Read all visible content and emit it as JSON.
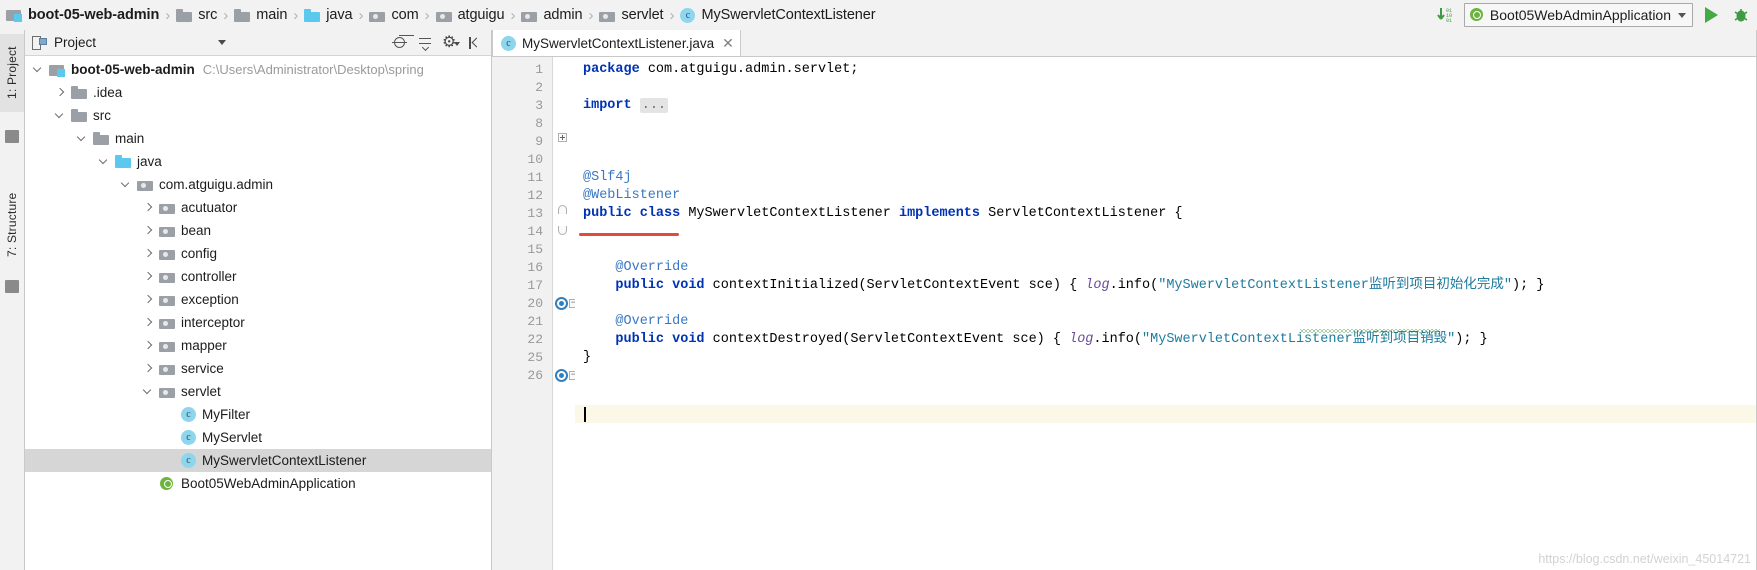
{
  "navbar": {
    "breadcrumb": [
      {
        "label": "boot-05-web-admin",
        "icon": "module-icon"
      },
      {
        "label": "src",
        "icon": "folder-icon"
      },
      {
        "label": "main",
        "icon": "folder-icon"
      },
      {
        "label": "java",
        "icon": "source-folder-icon"
      },
      {
        "label": "com",
        "icon": "package-icon"
      },
      {
        "label": "atguigu",
        "icon": "package-icon"
      },
      {
        "label": "admin",
        "icon": "package-icon"
      },
      {
        "label": "servlet",
        "icon": "package-icon"
      },
      {
        "label": "MySwervletContextListener",
        "icon": "java-class-icon"
      }
    ],
    "separator": "›",
    "run_config": {
      "label": "Boot05WebAdminApplication",
      "icon": "spring-boot-icon",
      "dropdown_icon": "chevron-down-icon"
    },
    "download_icon": "download-binary-icon",
    "run_icon": "run-triangle-icon",
    "debug_icon": "debug-bug-icon"
  },
  "toolstrip": {
    "project_tab": "1: Project",
    "structure_tab": "7: Structure"
  },
  "project_panel": {
    "title": "Project",
    "header_icons": [
      "select-opened-file-icon",
      "collapse-all-icon",
      "settings-gear-icon",
      "hide-panel-icon"
    ],
    "tree": [
      {
        "label": "boot-05-web-admin",
        "path": "C:\\Users\\Administrator\\Desktop\\spring",
        "indent": 0,
        "arrow": "down",
        "icon": "module-icon",
        "bold": true,
        "selected": false
      },
      {
        "label": ".idea",
        "path": "",
        "indent": 1,
        "arrow": "right",
        "icon": "folder-icon",
        "bold": false,
        "selected": false
      },
      {
        "label": "src",
        "path": "",
        "indent": 1,
        "arrow": "down",
        "icon": "folder-icon",
        "bold": false,
        "selected": false
      },
      {
        "label": "main",
        "path": "",
        "indent": 2,
        "arrow": "down",
        "icon": "folder-icon",
        "bold": false,
        "selected": false
      },
      {
        "label": "java",
        "path": "",
        "indent": 3,
        "arrow": "down",
        "icon": "source-folder-icon",
        "bold": false,
        "selected": false
      },
      {
        "label": "com.atguigu.admin",
        "path": "",
        "indent": 4,
        "arrow": "down",
        "icon": "package-icon",
        "bold": false,
        "selected": false
      },
      {
        "label": "acutuator",
        "path": "",
        "indent": 5,
        "arrow": "right",
        "icon": "package-icon",
        "bold": false,
        "selected": false
      },
      {
        "label": "bean",
        "path": "",
        "indent": 5,
        "arrow": "right",
        "icon": "package-icon",
        "bold": false,
        "selected": false
      },
      {
        "label": "config",
        "path": "",
        "indent": 5,
        "arrow": "right",
        "icon": "package-icon",
        "bold": false,
        "selected": false
      },
      {
        "label": "controller",
        "path": "",
        "indent": 5,
        "arrow": "right",
        "icon": "package-icon",
        "bold": false,
        "selected": false
      },
      {
        "label": "exception",
        "path": "",
        "indent": 5,
        "arrow": "right",
        "icon": "package-icon",
        "bold": false,
        "selected": false
      },
      {
        "label": "interceptor",
        "path": "",
        "indent": 5,
        "arrow": "right",
        "icon": "package-icon",
        "bold": false,
        "selected": false
      },
      {
        "label": "mapper",
        "path": "",
        "indent": 5,
        "arrow": "right",
        "icon": "package-icon",
        "bold": false,
        "selected": false
      },
      {
        "label": "service",
        "path": "",
        "indent": 5,
        "arrow": "right",
        "icon": "package-icon",
        "bold": false,
        "selected": false
      },
      {
        "label": "servlet",
        "path": "",
        "indent": 5,
        "arrow": "down",
        "icon": "package-icon",
        "bold": false,
        "selected": false
      },
      {
        "label": "MyFilter",
        "path": "",
        "indent": 6,
        "arrow": "none",
        "icon": "java-class-icon",
        "bold": false,
        "selected": false
      },
      {
        "label": "MyServlet",
        "path": "",
        "indent": 6,
        "arrow": "none",
        "icon": "java-class-icon",
        "bold": false,
        "selected": false
      },
      {
        "label": "MySwervletContextListener",
        "path": "",
        "indent": 6,
        "arrow": "none",
        "icon": "java-class-icon",
        "bold": false,
        "selected": true
      },
      {
        "label": "Boot05WebAdminApplication",
        "path": "",
        "indent": 5,
        "arrow": "none",
        "icon": "spring-boot-class-icon",
        "bold": false,
        "selected": false
      }
    ]
  },
  "editor": {
    "tab": {
      "label": "MySwervletContextListener.java",
      "icon": "java-class-icon",
      "close_icon": "close-icon"
    },
    "line_numbers": [
      "1",
      "2",
      "3",
      "8",
      "9",
      "10",
      "11",
      "12",
      "13",
      "14",
      "15",
      "16",
      "17",
      "20",
      "21",
      "22",
      "25",
      "26"
    ],
    "lines": [
      {
        "num": "1",
        "text": "package com.atguigu.admin.servlet;"
      },
      {
        "num": "2",
        "text": ""
      },
      {
        "num": "3",
        "text": "import ..."
      },
      {
        "num": "8",
        "text": ""
      },
      {
        "num": "9",
        "text": ""
      },
      {
        "num": "10",
        "text": ""
      },
      {
        "num": "11",
        "text": "@Slf4j"
      },
      {
        "num": "12",
        "text": "@WebListener"
      },
      {
        "num": "13",
        "text": "public class MySwervletContextListener implements ServletContextListener {"
      },
      {
        "num": "14",
        "text": ""
      },
      {
        "num": "15",
        "text": ""
      },
      {
        "num": "16",
        "text": "    @Override"
      },
      {
        "num": "17",
        "text": "    public void contextInitialized(ServletContextEvent sce) { log.info(\"MySwervletContextListener监听到项目初始化完成\"); }"
      },
      {
        "num": "20",
        "text": ""
      },
      {
        "num": "21",
        "text": "    @Override"
      },
      {
        "num": "22",
        "text": "    public void contextDestroyed(ServletContextEvent sce) { log.info(\"MySwervletContextListener监听到项目销毁\"); }"
      },
      {
        "num": "25",
        "text": "}"
      },
      {
        "num": "26",
        "text": ""
      }
    ],
    "tokens": {
      "l1_kw": "package",
      "l1_rest": " com.atguigu.admin.servlet;",
      "l3_kw": "import",
      "l3_fold": "...",
      "l11_ann": "@Slf4j",
      "l12_ann": "@WebListener",
      "l13_kw1": "public",
      "l13_kw2": "class",
      "l13_name": "MySwervletContextListener",
      "l13_kw3": "implements",
      "l13_iface": "ServletContextListener",
      "l13_brace": "{",
      "l16_ann": "@Override",
      "l17_kw1": "public",
      "l17_kw2": "void",
      "l17_sig": "contextInitialized(ServletContextEvent sce) { ",
      "l17_log": "log",
      "l17_info": ".info(",
      "l17_str": "\"MySwervletContextListener监听到项目初始化完成\"",
      "l17_end": "); }",
      "l21_ann": "@Override",
      "l22_kw1": "public",
      "l22_kw2": "void",
      "l22_sig": "contextDestroyed(ServletContextEvent sce) { ",
      "l22_log": "log",
      "l22_info": ".info(",
      "l22_str": "\"MySwervletContextListener监听到项目销毁\"",
      "l22_end": "); }",
      "l25_brace": "}"
    },
    "watermark": "https://blog.csdn.net/weixin_45014721"
  },
  "colors": {
    "accent_blue": "#3b78c4",
    "keyword_blue": "#0033b3",
    "string_teal": "#1d7b9e",
    "error_red": "#e04a3f",
    "selection_gray": "#d6d6d6",
    "spring_green": "#6db33f",
    "folder_gray": "#9aa0a6",
    "source_cyan": "#5bc8ee",
    "current_line": "#fcf8e8"
  }
}
